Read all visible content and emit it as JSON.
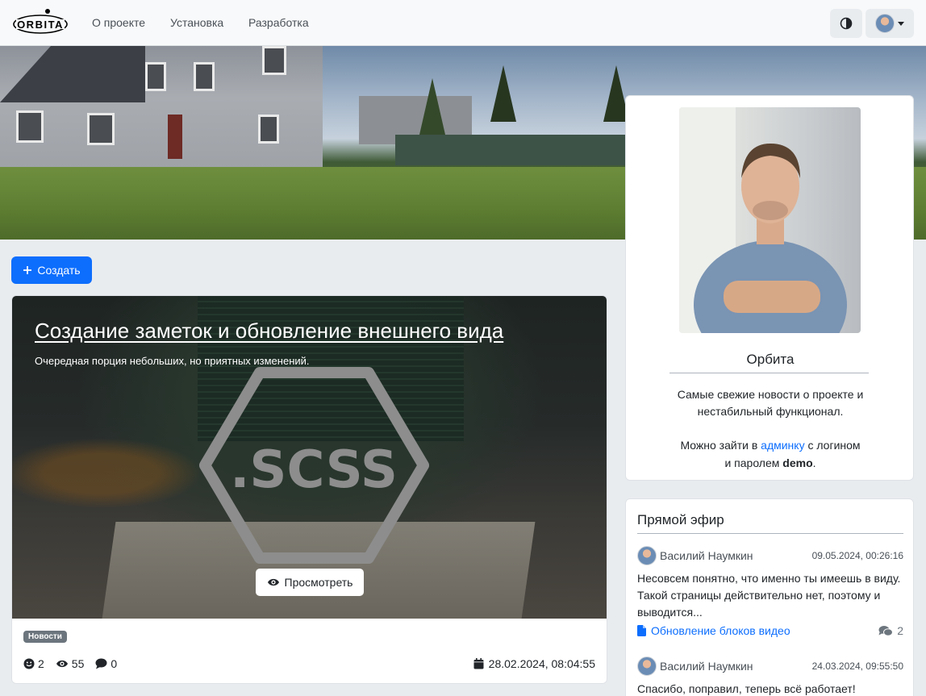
{
  "navbar": {
    "logo_text": "ORBITA",
    "links": [
      "О проекте",
      "Установка",
      "Разработка"
    ]
  },
  "create_button": "Создать",
  "post": {
    "title": "Создание заметок и обновление внешнего вида",
    "subtitle": "Очередная порция небольших, но приятных изменений.",
    "cover_text": ".SCSS",
    "view_button": "Просмотреть",
    "badge": "Новости",
    "likes": "2",
    "views": "55",
    "comments": "0",
    "date": "28.02.2024, 08:04:55"
  },
  "profile": {
    "name": "Орбита",
    "desc_line1": "Самые свежие новости о проекте и",
    "desc_line2": "нестабильный функционал.",
    "login_pre": "Можно зайти в",
    "login_link": "админку",
    "login_mid": "с логином",
    "login_pre2": "и паролем",
    "login_user": "demo",
    "login_end": "."
  },
  "live": {
    "title": "Прямой эфир",
    "comments": [
      {
        "author": "Василий Наумкин",
        "date": "09.05.2024, 00:26:16",
        "text": "Несовсем понятно, что именно ты имеешь в виду. Такой страницы действительно нет, поэтому и выводится...",
        "link": "Обновление блоков видео",
        "count": "2"
      },
      {
        "author": "Василий Наумкин",
        "date": "24.03.2024, 09:55:50",
        "text": "Спасибо, поправил, теперь всё работает!"
      }
    ]
  },
  "colors": {
    "primary": "#0d6efd",
    "badge": "#6c757d",
    "navbar": "#f8f9fa",
    "page_bg": "#e9ecef"
  }
}
